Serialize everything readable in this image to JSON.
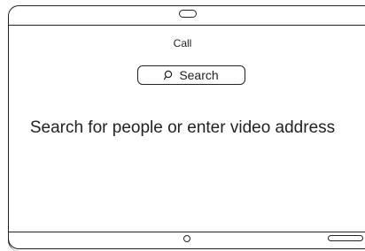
{
  "header": {
    "title": "Call"
  },
  "search": {
    "label": "Search",
    "icon": "search-icon"
  },
  "main": {
    "prompt": "Search for people or enter video address"
  },
  "colors": {
    "line": "#222222",
    "background": "#ffffff"
  }
}
